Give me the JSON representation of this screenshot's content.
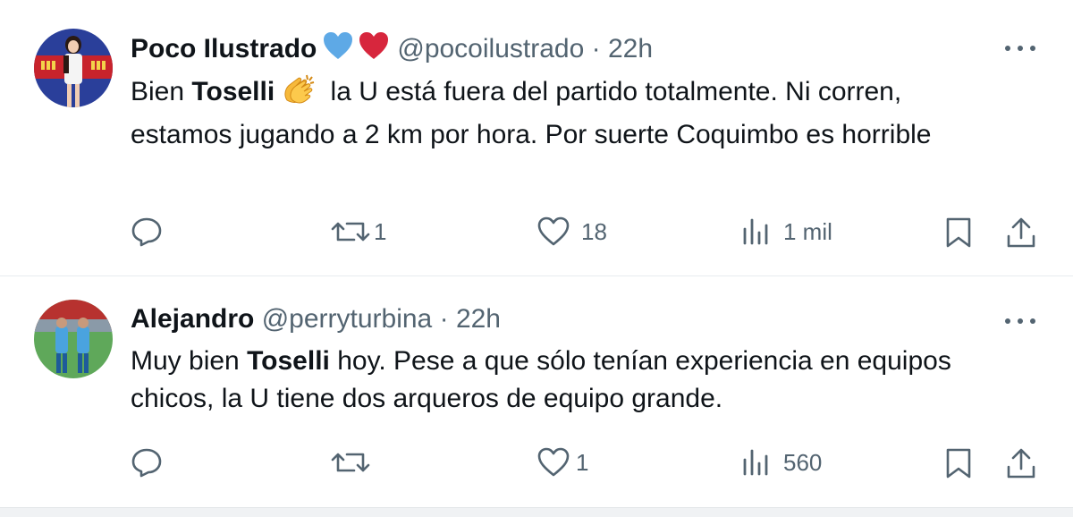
{
  "tweets": [
    {
      "name": "Poco Ilustrado",
      "handle": "@pocoilustrado",
      "separator": "·",
      "time": "22h",
      "text_before": "Bien ",
      "text_bold": "Toselli",
      "text_after": " la U está fuera del partido totalmente. Ni corren, estamos jugando a 2 km por hora. Por suerte Coquimbo es horrible",
      "counts": {
        "reply": "",
        "retweet": "1",
        "like": "18",
        "views": "1 mil"
      }
    },
    {
      "name": "Alejandro",
      "handle": "@perryturbina",
      "separator": "·",
      "time": "22h",
      "text_before": "Muy bien ",
      "text_bold": "Toselli",
      "text_after": " hoy. Pese a que sólo tenían experiencia en equipos chicos, la U tiene dos arqueros de equipo grande.",
      "counts": {
        "reply": "",
        "retweet": "",
        "like": "1",
        "views": "560"
      }
    }
  ],
  "icons": [
    "blue-heart-icon",
    "red-heart-icon",
    "clapping-hands-icon",
    "more-icon",
    "reply-icon",
    "retweet-icon",
    "like-icon",
    "views-icon",
    "bookmark-icon",
    "share-icon"
  ],
  "colors": {
    "text": "#0f1419",
    "secondary": "#536471",
    "divider": "#e8ecef",
    "blue_heart": "#5ea9e6",
    "red_heart": "#d7263d"
  }
}
